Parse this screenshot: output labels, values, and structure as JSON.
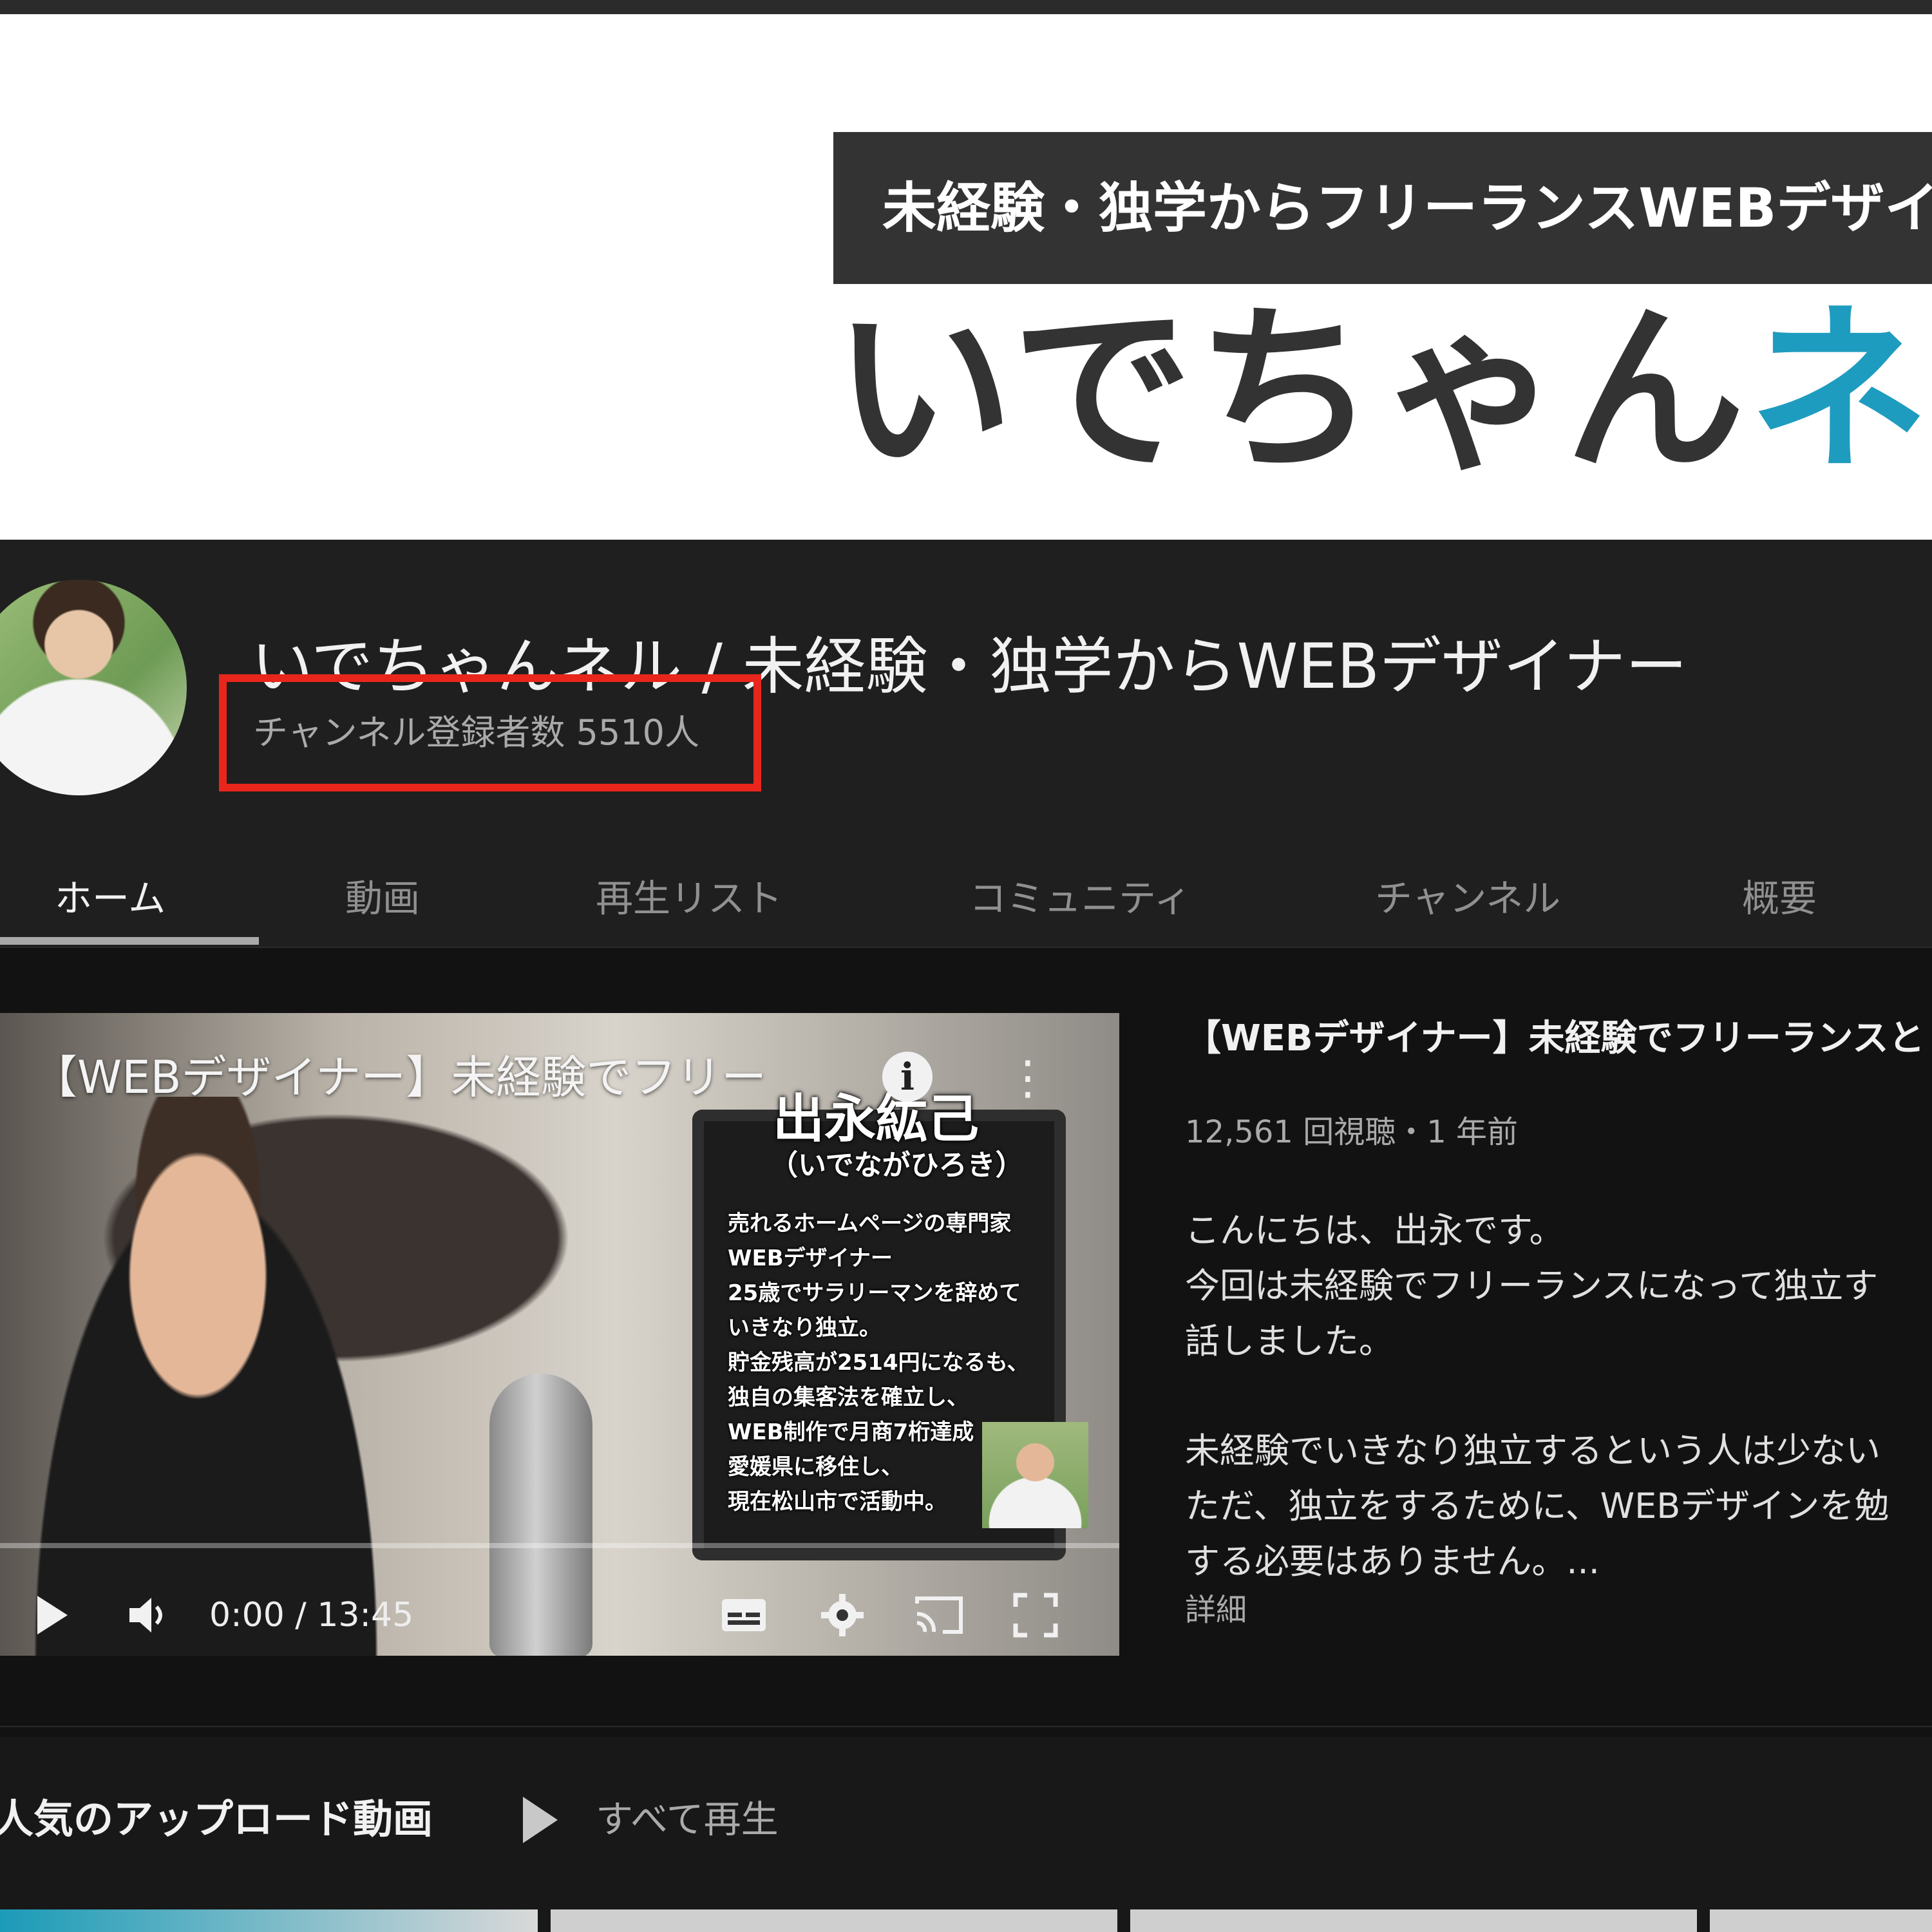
{
  "banner": {
    "tagline": "未経験・独学からフリーランスWEBデザイナー",
    "title_main": "いでちゃん",
    "title_accent": "ネル"
  },
  "channel": {
    "name": "いでちゃんネル / 未経験・独学からWEBデザイナー",
    "subscribers": "チャンネル登録者数 5510人"
  },
  "tabs": [
    "ホーム",
    "動画",
    "再生リスト",
    "コミュニティ",
    "チャンネル",
    "概要"
  ],
  "player": {
    "title_overlay": "【WEBデザイナー】未経験でフリー",
    "overlay_name": "出永紘己",
    "overlay_furigana": "（いでながひろき）",
    "overlay_profile": [
      "売れるホームページの専門家",
      "WEBデザイナー",
      "25歳でサラリーマンを辞めて",
      "いきなり独立。",
      "貯金残高が2514円になるも、",
      "独自の集客法を確立し、",
      "WEB制作で月商7桁達成",
      "愛媛県に移住し、",
      "現在松山市で活動中。"
    ],
    "time": "0:00 / 13:45",
    "progress": 0.0
  },
  "video": {
    "title": "【WEBデザイナー】未経験でフリーランスと",
    "meta": "12,561 回視聴・1 年前",
    "desc_lines_1": [
      "こんにちは、出永です。",
      "今回は未経験でフリーランスになって独立す",
      "話しました。"
    ],
    "desc_lines_2": [
      "未経験でいきなり独立するという人は少ない",
      "ただ、独立をするために、WEBデザインを勉",
      "する必要はありません。..."
    ],
    "details": "詳細"
  },
  "shelf": {
    "title": "人気のアップロード動画",
    "play_all": "すべて再生"
  },
  "colors": {
    "accent": "#1e9cbf",
    "highlight_box": "#e8261c"
  }
}
